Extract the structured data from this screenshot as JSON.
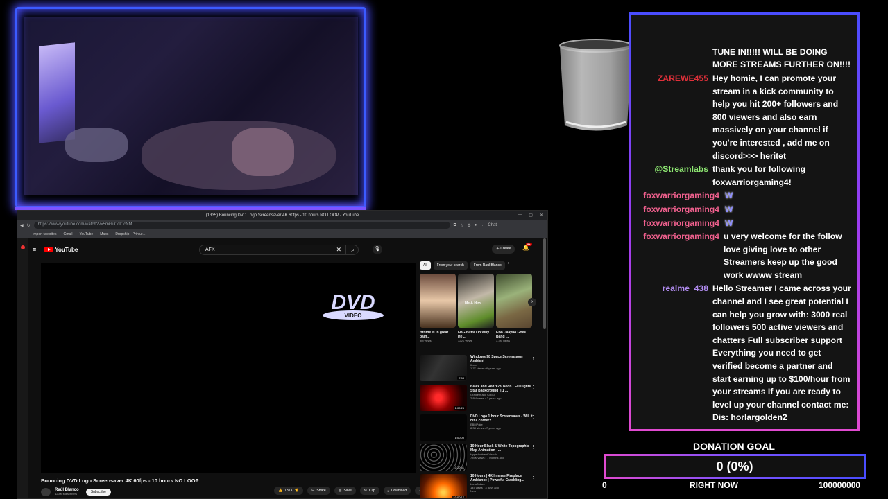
{
  "browser": {
    "tab_title": "(1335) Bouncing DVD Logo Screensaver 4K 60fps - 10 hours NO LOOP - YouTube",
    "url": "https://www.youtube.com/watch?v=5mGuCdlCcNM",
    "bookmarks": [
      "Import favorites",
      "Gmail",
      "YouTube",
      "Maps",
      "Dropship - Printur..."
    ],
    "chat_label": "Chat"
  },
  "youtube": {
    "logo": "YouTube",
    "search_value": "AFK",
    "create_label": "Create",
    "notif_count": "9+",
    "video": {
      "title": "Bouncing DVD Logo Screensaver 4K 60fps - 10 hours NO LOOP",
      "channel": "Raúl Blanco",
      "subscribers": "12.8K subscribers",
      "subscribe_label": "Subscribe",
      "likes": "131K",
      "share_label": "Share",
      "save_label": "Save",
      "clip_label": "Clip",
      "download_label": "Download",
      "logo_text": "DVD",
      "logo_sub": "VIDEO"
    },
    "chips": [
      "All",
      "From your search",
      "From Raúl Blanco"
    ],
    "shorts": [
      {
        "title": "Brothe is in great pain...",
        "views": "9M views",
        "caption": ""
      },
      {
        "title": "FBG Butta On Why He ...",
        "views": "322K views",
        "caption": "Me & Him"
      },
      {
        "title": "EBK Jaaybo Goes Band ...",
        "views": "3.3M views",
        "caption": ""
      }
    ],
    "recs": [
      {
        "title": "Windows 98 Space Screensaver Ambient",
        "channel": "Ibxco",
        "meta": "1.7K views • 6 years ago",
        "duration": "7:58",
        "bg": "linear-gradient(120deg,#111,#333 40%,#111)"
      },
      {
        "title": "Black and Red Y2K Neon LED Lights Star Background || 1 ...",
        "channel": "Gradient and Colour",
        "meta": "2.8M views • 2 years ago",
        "duration": "1:00:25",
        "bg": "radial-gradient(circle at 40% 50%,#ff2a2a 10%,#8a0000 40%,#1a0000 80%)"
      },
      {
        "title": "DVD Logo 1 hour Screensaver - Will it hit a corner?",
        "channel": "EBMPoke",
        "meta": "8.3K views • 7 years ago",
        "duration": "1:00:00",
        "bg": "#050505"
      },
      {
        "title": "10 Hour Black & White Topographic Map Animation –...",
        "channel": "HyperAmbient Visuals",
        "meta": "739K views • 7 months ago",
        "duration": "10:20:51",
        "bg": "repeating-radial-gradient(circle at 30% 40%,#000 0,#000 3px,#777 4px,#000 5px)"
      },
      {
        "title": "10 Hours | 4K Intense Fireplace Ambiance | Powerful Crackling...",
        "channel": "LunaSolace",
        "meta": "145 views • 3 days ago",
        "duration": "10:00:17",
        "badge": "New",
        "bg": "radial-gradient(circle at 50% 70%,#ffcf4a 5%,#ff6a00 30%,#5a1800 70%,#1a0800)"
      }
    ]
  },
  "chat": {
    "messages": [
      {
        "user": "",
        "user_color": "#ffffff",
        "text": "TUNE IN!!!!! WILL BE DOING MORE STREAMS FURTHER ON!!!!"
      },
      {
        "user": "ZAREWE455",
        "user_color": "#e0303a",
        "text": "Hey homie, I can promote your stream in a kick community to help you hit 200+ followers and 800 viewers and also earn massively on your channel if you're interested , add me on discord>>> heritet"
      },
      {
        "user": "@Streamlabs",
        "user_color": "#8ee872",
        "text": "thank you for following foxwarriorgaming4!"
      },
      {
        "user": "foxwarriorgaming4",
        "user_color": "#f0608e",
        "text": "",
        "emote": "W"
      },
      {
        "user": "foxwarriorgaming4",
        "user_color": "#f0608e",
        "text": "",
        "emote": "W"
      },
      {
        "user": "foxwarriorgaming4",
        "user_color": "#f0608e",
        "text": "",
        "emote": "W"
      },
      {
        "user": "foxwarriorgaming4",
        "user_color": "#f0608e",
        "text": "u very welcome for the follow love giving love to other Streamers keep up the good work wwww stream"
      },
      {
        "user": "realme_438",
        "user_color": "#b18cf0",
        "text": "Hello Streamer I came across your channel and I see great potential I can help you grow with: 3000 real followers 500 active viewers and chatters Full subscriber support Everything you need to get verified become a partner and start earning up to $100/hour from your streams If you are ready to level up your channel contact me: Dis: horlargolden2"
      }
    ]
  },
  "donation": {
    "title": "DONATION GOAL",
    "value": "0 (0%)",
    "progress": 0,
    "min": "0",
    "now_label": "RIGHT NOW",
    "max": "100000000"
  }
}
